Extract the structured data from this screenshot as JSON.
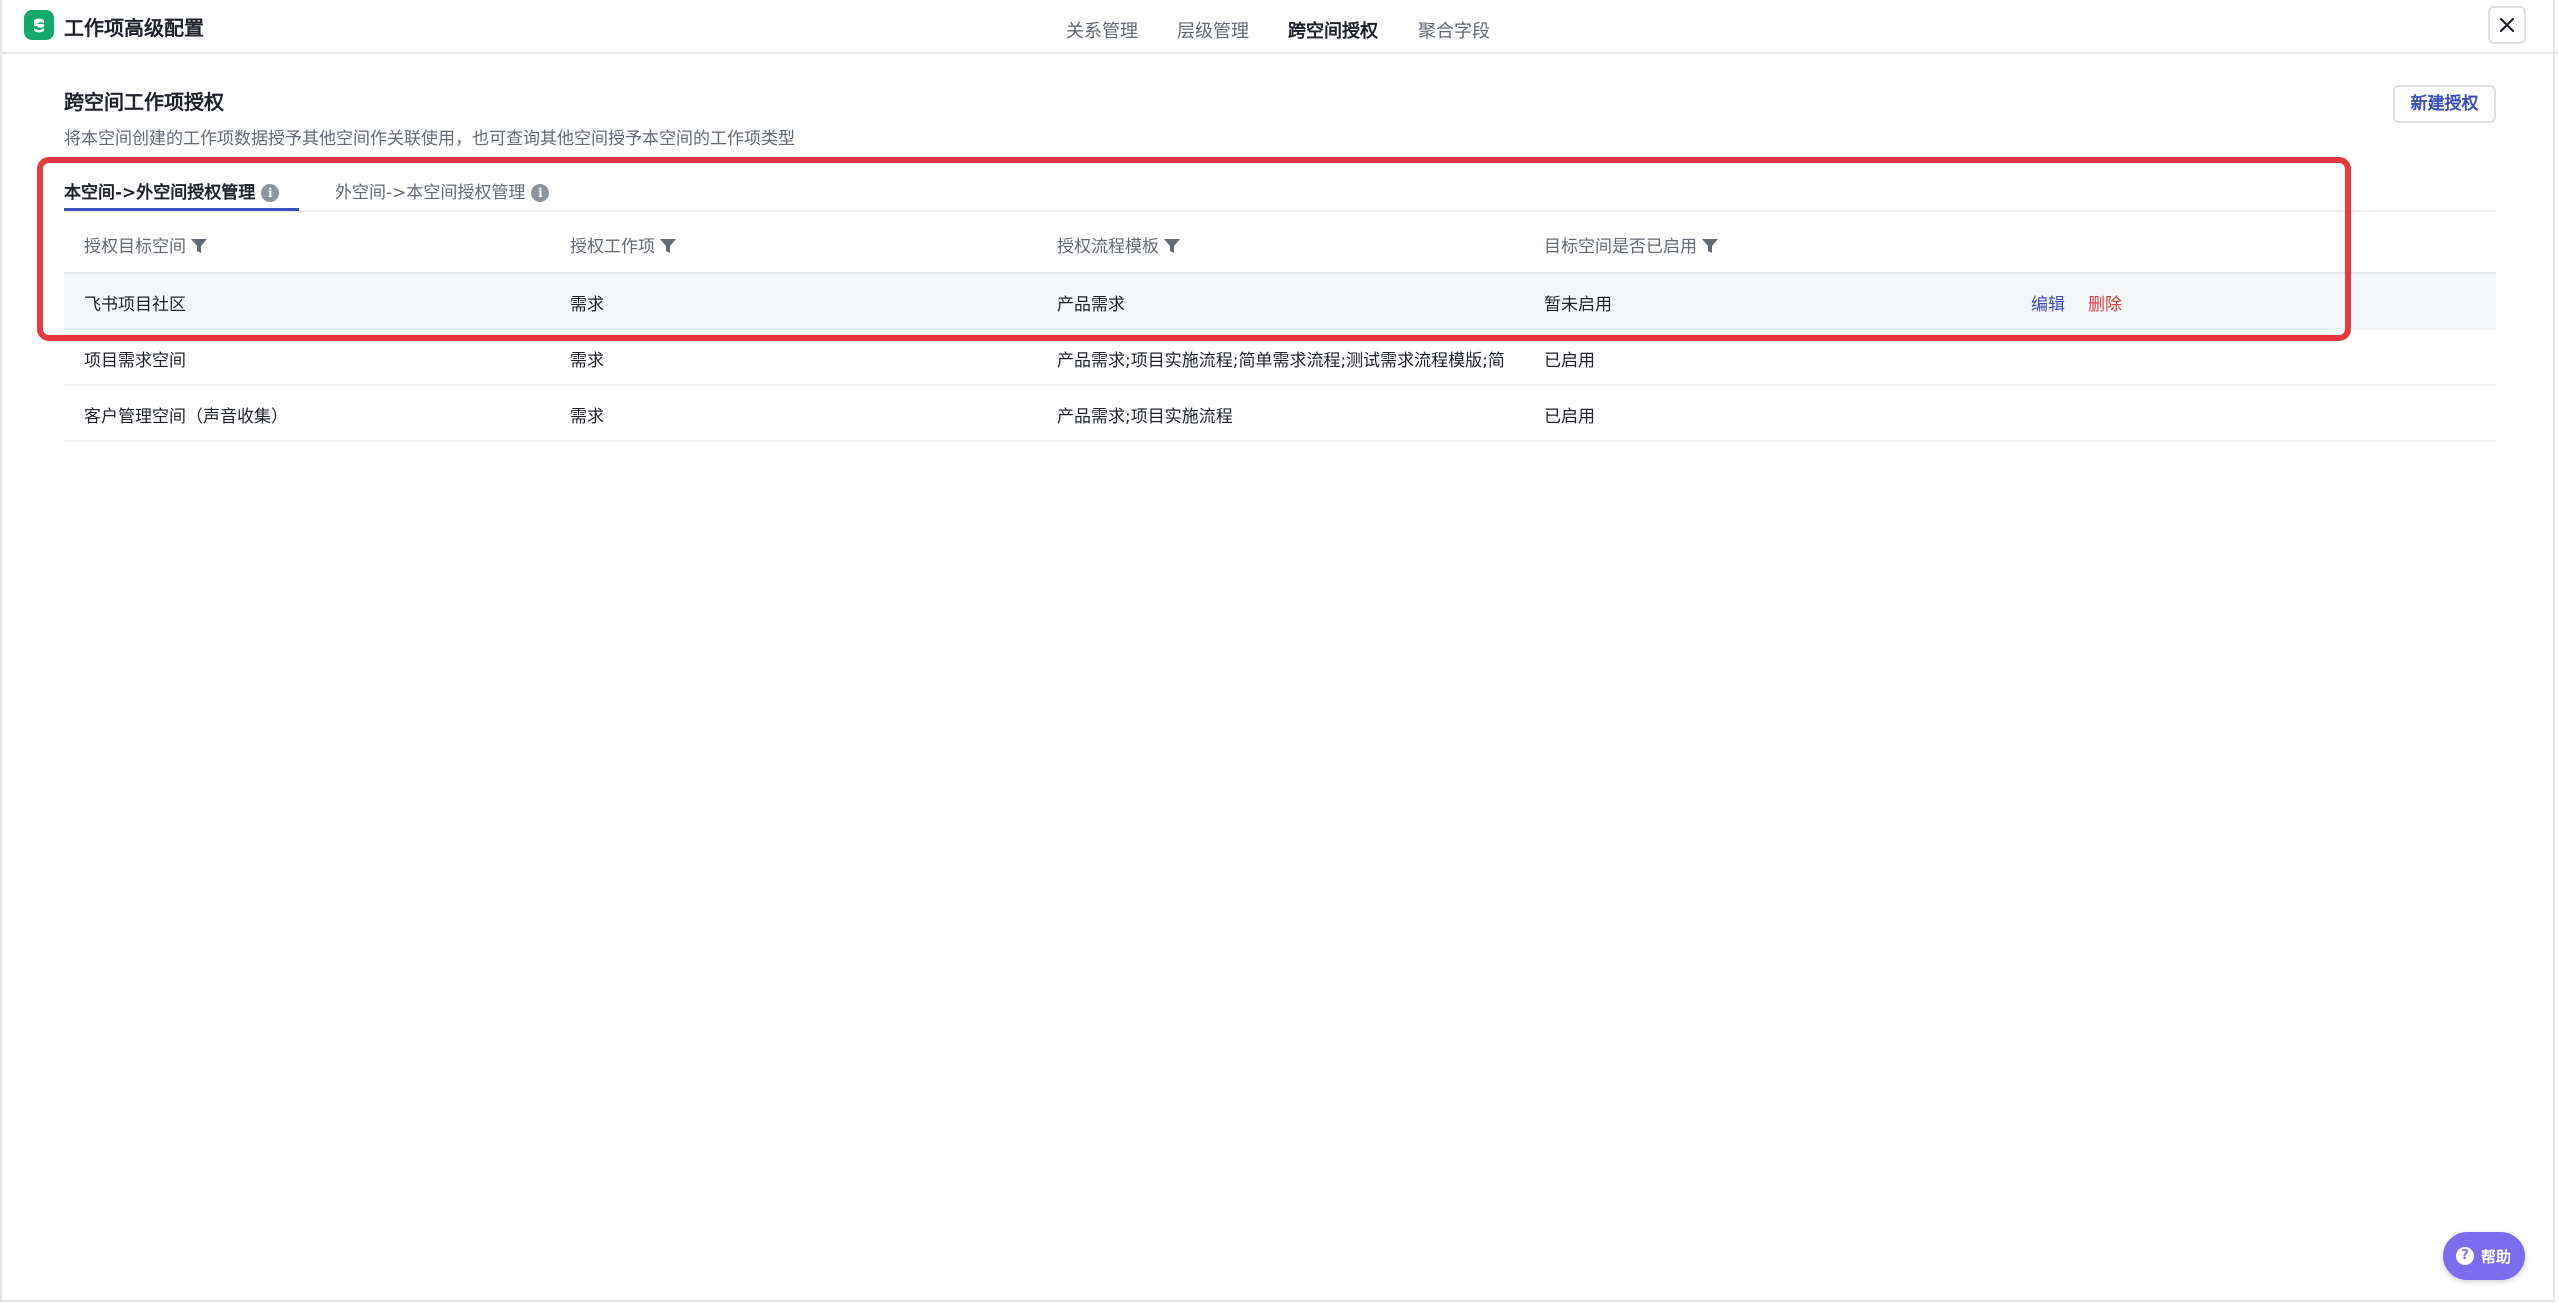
{
  "header": {
    "title": "工作项高级配置",
    "nav": [
      "关系管理",
      "层级管理",
      "跨空间授权",
      "聚合字段"
    ],
    "active_nav": "跨空间授权"
  },
  "section": {
    "title": "跨空间工作项授权",
    "description": "将本空间创建的工作项数据授予其他空间作关联使用，也可查询其他空间授予本空间的工作项类型",
    "new_button": "新建授权"
  },
  "tabs": [
    {
      "label": "本空间->外空间授权管理",
      "active": true
    },
    {
      "label": "外空间->本空间授权管理",
      "active": false
    }
  ],
  "table": {
    "columns": [
      "授权目标空间",
      "授权工作项",
      "授权流程模板",
      "目标空间是否已启用"
    ],
    "rows": [
      {
        "space": "飞书项目社区",
        "item": "需求",
        "template": "产品需求",
        "enabled": "暂未启用",
        "edit": "编辑",
        "delete": "删除"
      },
      {
        "space": "项目需求空间",
        "item": "需求",
        "template": "产品需求;项目实施流程;简单需求流程;测试需求流程模版;简",
        "enabled": "已启用"
      },
      {
        "space": "客户管理空间（声音收集）",
        "item": "需求",
        "template": "产品需求;项目实施流程",
        "enabled": "已启用"
      }
    ]
  },
  "help": {
    "label": "帮助"
  },
  "colors": {
    "accent": "#3a4fb8",
    "danger": "#e23d3d",
    "highlight": "#e8393e",
    "brand": "#14a86a",
    "help": "#7b6cf0"
  }
}
